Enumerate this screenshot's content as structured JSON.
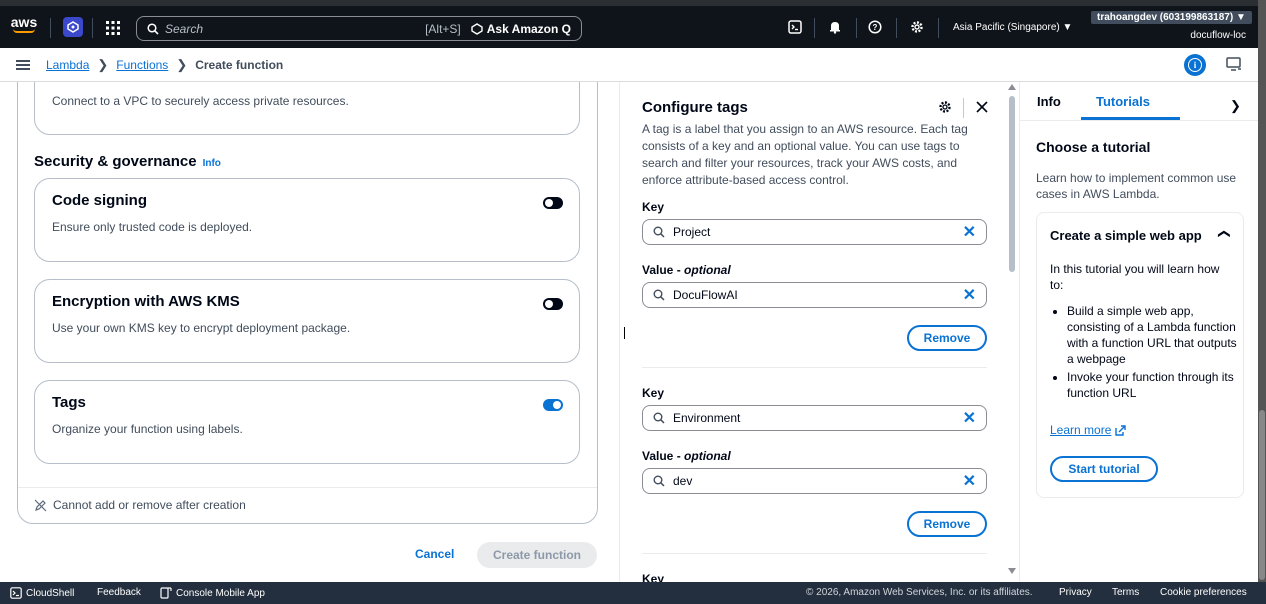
{
  "topbar": {
    "logo": "aws",
    "search_placeholder": "Search",
    "search_shortcut": "[Alt+S]",
    "ask_q": "Ask Amazon Q",
    "region": "Asia Pacific (Singapore) ▼",
    "account": "trahoangdev (603199863187) ▼",
    "subaccount": "docuflow-loc"
  },
  "breadcrumb": {
    "items": [
      "Lambda",
      "Functions"
    ],
    "current": "Create function"
  },
  "left": {
    "vpc_desc": "Connect to a VPC to securely access private resources.",
    "section_title": "Security & governance",
    "section_info": "Info",
    "cards": [
      {
        "title": "Code signing",
        "desc": "Ensure only trusted code is deployed.",
        "on": false
      },
      {
        "title": "Encryption with AWS KMS",
        "desc": "Use your own KMS key to encrypt deployment package.",
        "on": false
      },
      {
        "title": "Tags",
        "desc": "Organize your function using labels.",
        "on": true
      }
    ],
    "notice": "Cannot add or remove after creation",
    "cancel": "Cancel",
    "create": "Create function"
  },
  "tags": {
    "title": "Configure tags",
    "desc": "A tag is a label that you assign to an AWS resource. Each tag consists of a key and an optional value. You can use tags to search and filter your resources, track your AWS costs, and enforce attribute-based access control.",
    "key_label": "Key",
    "value_label": "Value - ",
    "value_optional": "optional",
    "remove": "Remove",
    "items": [
      {
        "key": "Project",
        "value": "DocuFlowAI"
      },
      {
        "key": "Environment",
        "value": "dev"
      }
    ],
    "next_key_label": "Key"
  },
  "help": {
    "tab_info": "Info",
    "tab_tutorials": "Tutorials",
    "title": "Choose a tutorial",
    "desc": "Learn how to implement common use cases in AWS Lambda.",
    "tutorial_title": "Create a simple web app",
    "tutorial_intro": "In this tutorial you will learn how to:",
    "bullets": [
      "Build a simple web app, consisting of a Lambda function with a function URL that outputs a webpage",
      "Invoke your function through its function URL"
    ],
    "learn_more": "Learn more",
    "start": "Start tutorial"
  },
  "footer": {
    "cloudshell": "CloudShell",
    "feedback": "Feedback",
    "mobile": "Console Mobile App",
    "copyright": "© 2026, Amazon Web Services, Inc. or its affiliates.",
    "privacy": "Privacy",
    "terms": "Terms",
    "cookies": "Cookie preferences"
  }
}
